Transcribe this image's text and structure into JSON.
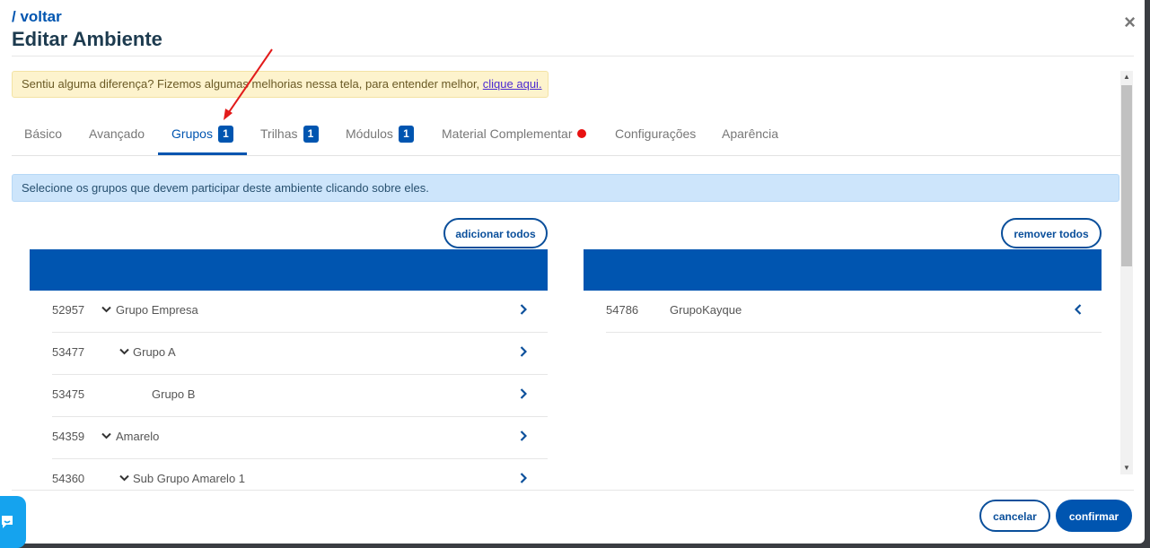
{
  "header": {
    "back_label": "/ voltar",
    "title": "Editar Ambiente",
    "close_label": "×"
  },
  "notice": {
    "text": "Sentiu alguma diferença? Fizemos algumas melhorias nessa tela, para entender melhor, ",
    "link": "clique aqui."
  },
  "tabs": [
    {
      "label": "Básico",
      "badge": null
    },
    {
      "label": "Avançado",
      "badge": null
    },
    {
      "label": "Grupos",
      "badge": "1",
      "active": true
    },
    {
      "label": "Trilhas",
      "badge": "1"
    },
    {
      "label": "Módulos",
      "badge": "1"
    },
    {
      "label": "Material Complementar",
      "dot": "#e81111"
    },
    {
      "label": "Configurações",
      "badge": null
    },
    {
      "label": "Aparência",
      "badge": null
    }
  ],
  "info_text": "Selecione os grupos que devem participar deste ambiente clicando sobre eles.",
  "left_panel": {
    "button_label": "adicionar todos",
    "rows": [
      {
        "id": "52957",
        "name": "Grupo Empresa",
        "expanded": true,
        "level": 0
      },
      {
        "id": "53477",
        "name": "Grupo A",
        "expanded": true,
        "level": 1
      },
      {
        "id": "53475",
        "name": "Grupo B",
        "expanded": false,
        "level": 2
      },
      {
        "id": "54359",
        "name": "Amarelo",
        "expanded": true,
        "level": 0
      },
      {
        "id": "54360",
        "name": "Sub Grupo Amarelo 1",
        "expanded": true,
        "level": 1
      }
    ]
  },
  "right_panel": {
    "button_label": "remover todos",
    "rows": [
      {
        "id": "54786",
        "name": "GrupoKayque"
      }
    ]
  },
  "footer": {
    "cancel_label": "cancelar",
    "confirm_label": "confirmar"
  },
  "colors": {
    "primary": "#0055b0",
    "notice_bg": "#fdf3cd",
    "info_bg": "#cde5fb",
    "annotation_arrow": "#e21b1b"
  }
}
